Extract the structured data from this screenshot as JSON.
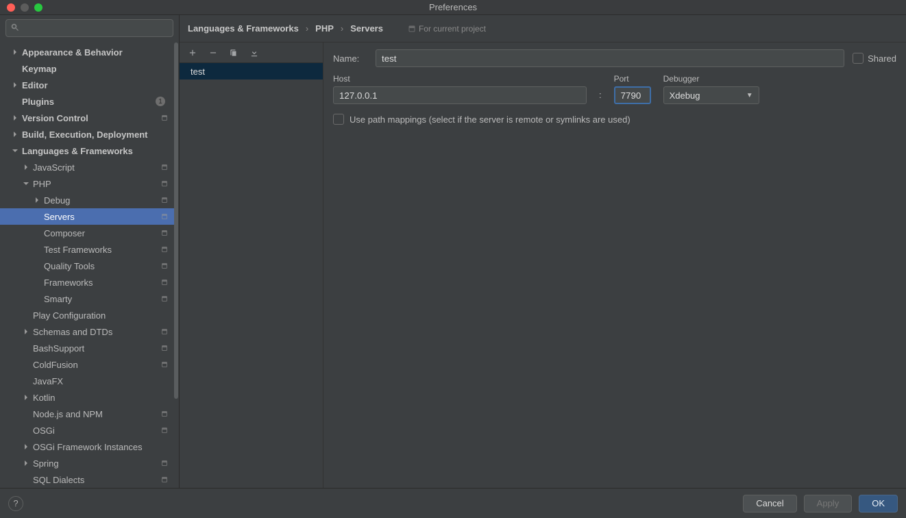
{
  "window": {
    "title": "Preferences"
  },
  "search": {
    "placeholder": ""
  },
  "sidebar": {
    "items": [
      {
        "label": "Appearance & Behavior",
        "arrow": "right",
        "bold": true,
        "indent": 0
      },
      {
        "label": "Keymap",
        "arrow": "none",
        "bold": true,
        "indent": 0
      },
      {
        "label": "Editor",
        "arrow": "right",
        "bold": true,
        "indent": 0
      },
      {
        "label": "Plugins",
        "arrow": "none",
        "bold": true,
        "indent": 0,
        "badge": "1"
      },
      {
        "label": "Version Control",
        "arrow": "right",
        "bold": true,
        "indent": 0,
        "proj": true
      },
      {
        "label": "Build, Execution, Deployment",
        "arrow": "right",
        "bold": true,
        "indent": 0
      },
      {
        "label": "Languages & Frameworks",
        "arrow": "down",
        "bold": true,
        "indent": 0
      },
      {
        "label": "JavaScript",
        "arrow": "right",
        "indent": 1,
        "proj": true
      },
      {
        "label": "PHP",
        "arrow": "down",
        "indent": 1,
        "proj": true
      },
      {
        "label": "Debug",
        "arrow": "right",
        "indent": 2,
        "proj": true
      },
      {
        "label": "Servers",
        "arrow": "none",
        "indent": 2,
        "proj": true,
        "selected": true
      },
      {
        "label": "Composer",
        "arrow": "none",
        "indent": 2,
        "proj": true
      },
      {
        "label": "Test Frameworks",
        "arrow": "none",
        "indent": 2,
        "proj": true
      },
      {
        "label": "Quality Tools",
        "arrow": "none",
        "indent": 2,
        "proj": true
      },
      {
        "label": "Frameworks",
        "arrow": "none",
        "indent": 2,
        "proj": true
      },
      {
        "label": "Smarty",
        "arrow": "none",
        "indent": 2,
        "proj": true
      },
      {
        "label": "Play Configuration",
        "arrow": "none",
        "indent": 1
      },
      {
        "label": "Schemas and DTDs",
        "arrow": "right",
        "indent": 1,
        "proj": true
      },
      {
        "label": "BashSupport",
        "arrow": "none",
        "indent": 1,
        "proj": true
      },
      {
        "label": "ColdFusion",
        "arrow": "none",
        "indent": 1,
        "proj": true
      },
      {
        "label": "JavaFX",
        "arrow": "none",
        "indent": 1
      },
      {
        "label": "Kotlin",
        "arrow": "right",
        "indent": 1
      },
      {
        "label": "Node.js and NPM",
        "arrow": "none",
        "indent": 1,
        "proj": true
      },
      {
        "label": "OSGi",
        "arrow": "none",
        "indent": 1,
        "proj": true
      },
      {
        "label": "OSGi Framework Instances",
        "arrow": "right",
        "indent": 1
      },
      {
        "label": "Spring",
        "arrow": "right",
        "indent": 1,
        "proj": true
      },
      {
        "label": "SQL Dialects",
        "arrow": "none",
        "indent": 1,
        "proj": true
      }
    ]
  },
  "breadcrumb": {
    "a": "Languages & Frameworks",
    "b": "PHP",
    "c": "Servers"
  },
  "for_project": "For current project",
  "servers_list": {
    "item0": "test"
  },
  "form": {
    "name_label": "Name:",
    "name_value": "test",
    "shared_label": "Shared",
    "host_label": "Host",
    "host_value": "127.0.0.1",
    "port_label": "Port",
    "port_value": "7790",
    "debugger_label": "Debugger",
    "debugger_value": "Xdebug",
    "colon": ":",
    "path_mappings_label": "Use path mappings (select if the server is remote or symlinks are used)"
  },
  "footer": {
    "help": "?",
    "cancel": "Cancel",
    "apply": "Apply",
    "ok": "OK"
  }
}
